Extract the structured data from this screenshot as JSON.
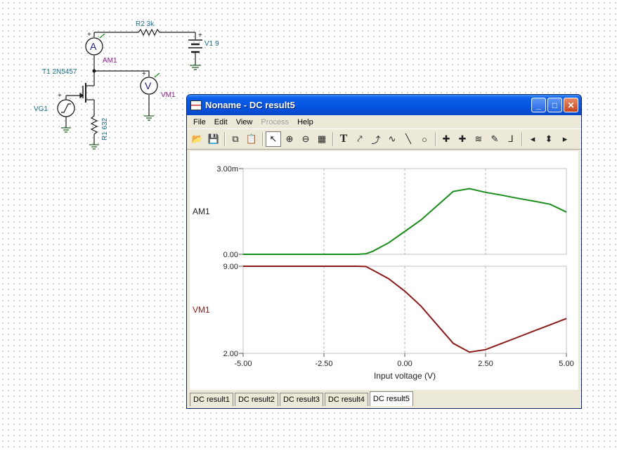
{
  "schematic": {
    "labels": {
      "r2": "R2 3k",
      "v1": "V1 9",
      "am1_symbol": "A",
      "am1": "AM1",
      "t1": "T1 2N5457",
      "vm1_symbol": "V",
      "vm1": "VM1",
      "vg1": "VG1",
      "r1": "R1 632",
      "plus": "+"
    }
  },
  "window": {
    "title": "Noname - DC result5",
    "controls": {
      "minimize": "_",
      "maximize": "□",
      "close": "✕"
    }
  },
  "menu": [
    {
      "label": "File",
      "enabled": true
    },
    {
      "label": "Edit",
      "enabled": true
    },
    {
      "label": "View",
      "enabled": true
    },
    {
      "label": "Process",
      "enabled": false
    },
    {
      "label": "Help",
      "enabled": true
    }
  ],
  "toolbar": [
    {
      "name": "open-icon",
      "glyph": "📂"
    },
    {
      "name": "save-icon",
      "glyph": "💾"
    },
    {
      "sep": true
    },
    {
      "name": "copy-icon",
      "glyph": "⧉"
    },
    {
      "name": "paste-icon",
      "glyph": "📋"
    },
    {
      "sep": true
    },
    {
      "name": "select-arrow-icon",
      "glyph": "↖",
      "pressed": true
    },
    {
      "name": "zoom-in-icon",
      "glyph": "⊕"
    },
    {
      "name": "zoom-out-icon",
      "glyph": "⊖"
    },
    {
      "name": "grid-icon",
      "glyph": "▦"
    },
    {
      "sep": true
    },
    {
      "name": "text-tool-icon",
      "glyph": "T",
      "bold": true
    },
    {
      "name": "curve-label-icon",
      "glyph": "⤤"
    },
    {
      "name": "curve-label2-icon",
      "glyph": "⤴"
    },
    {
      "name": "curve-fit-icon",
      "glyph": "∿"
    },
    {
      "name": "line-tool-icon",
      "glyph": "╲"
    },
    {
      "name": "circle-tool-icon",
      "glyph": "○"
    },
    {
      "sep": true
    },
    {
      "name": "cursor-a-icon",
      "glyph": "✚"
    },
    {
      "name": "cursor-b-icon",
      "glyph": "✚"
    },
    {
      "name": "curves-icon",
      "glyph": "≋"
    },
    {
      "name": "color-picker-icon",
      "glyph": "✎"
    },
    {
      "name": "arrow-tool-icon",
      "glyph": "⅃"
    },
    {
      "sep": true
    },
    {
      "name": "nav-left-icon",
      "glyph": "◂"
    },
    {
      "name": "nav-updown-icon",
      "glyph": "⬍"
    },
    {
      "name": "nav-right-icon",
      "glyph": "▸"
    }
  ],
  "chart_data": [
    {
      "type": "line",
      "series": [
        {
          "name": "AM1",
          "color": "#1a8c1a",
          "x": [
            -5,
            -4,
            -3,
            -2,
            -1.5,
            -1.2,
            -1.0,
            -0.5,
            0,
            0.5,
            1.0,
            1.5,
            2.0,
            2.5,
            3.0,
            3.5,
            4.0,
            4.5,
            5.0
          ],
          "y": [
            0,
            0,
            0,
            0,
            0,
            2e-05,
            0.0001,
            0.0004,
            0.0008,
            0.0012,
            0.0017,
            0.0022,
            0.0023,
            0.00217,
            0.00207,
            0.00196,
            0.00186,
            0.00175,
            0.00148
          ]
        }
      ],
      "ylim": [
        0,
        0.003
      ],
      "ytick_labels": [
        "0.00",
        "3.00m"
      ],
      "ylabel": "AM1",
      "xlim": [
        -5,
        5
      ]
    },
    {
      "type": "line",
      "series": [
        {
          "name": "VM1",
          "color": "#8b1a1a",
          "x": [
            -5,
            -4,
            -3,
            -2,
            -1.5,
            -1.2,
            -1.0,
            -0.5,
            0,
            0.5,
            1.0,
            1.5,
            2.0,
            2.5,
            3.0,
            3.5,
            4.0,
            4.5,
            5.0
          ],
          "y": [
            9,
            9,
            9,
            9,
            9,
            8.98,
            8.7,
            8.0,
            7.0,
            5.8,
            4.3,
            2.8,
            2.1,
            2.3,
            2.8,
            3.3,
            3.8,
            4.3,
            4.8
          ]
        }
      ],
      "ylim": [
        2,
        9
      ],
      "ytick_labels": [
        "2.00",
        "9.00"
      ],
      "ylabel": "VM1",
      "xlim": [
        -5,
        5
      ],
      "xticks": [
        -5,
        -2.5,
        0,
        2.5,
        5
      ],
      "xtick_labels": [
        "-5.00",
        "-2.50",
        "0.00",
        "2.50",
        "5.00"
      ],
      "xlabel": "Input voltage (V)",
      "grid": "dashed vertical"
    }
  ],
  "tabs": [
    {
      "label": "DC result1",
      "active": false
    },
    {
      "label": "DC result2",
      "active": false
    },
    {
      "label": "DC result3",
      "active": false
    },
    {
      "label": "DC result4",
      "active": false
    },
    {
      "label": "DC result5",
      "active": true
    }
  ]
}
